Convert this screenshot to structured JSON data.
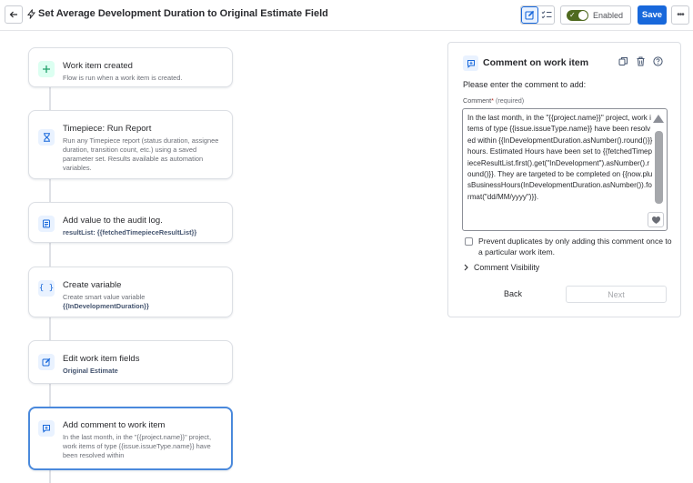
{
  "header": {
    "title": "Set Average Development Duration to Original Estimate Field",
    "enabled_label": "Enabled",
    "save_label": "Save",
    "more_label": "•••"
  },
  "flow": {
    "cards": [
      {
        "title": "Work item created",
        "description": "Flow is run when a work item is created.",
        "bold": "",
        "icon": "plus-icon"
      },
      {
        "title": "Timepiece: Run Report",
        "description": "Run any Timepiece report (status duration, assignee duration, transition count, etc.) using a saved parameter set. Results available as automation variables.",
        "bold": "",
        "icon": "hourglass-icon"
      },
      {
        "title": "Add value to the audit log.",
        "description": "",
        "bold": "resultList: {{fetchedTimepieceResultList}}",
        "icon": "audit-log-icon"
      },
      {
        "title": "Create variable",
        "description": "Create smart value variable",
        "bold": "{{InDevelopmentDuration}}",
        "icon": "braces-icon"
      },
      {
        "title": "Edit work item fields",
        "description": "",
        "bold": "Original Estimate",
        "icon": "edit-icon"
      },
      {
        "title": "Add comment to work item",
        "description": "In the last month, in the \"{{project.name}}\" project, work items of type {{issue.issueType.name}} have been resolved within",
        "bold": "",
        "icon": "comment-add-icon"
      }
    ]
  },
  "panel": {
    "title": "Comment on work item",
    "prompt": "Please enter the comment to add:",
    "comment_label": "Comment",
    "required_mark": "*",
    "required_text": "(required)",
    "comment_value": "In the last month, in the \"{{project.name}}\" project, work items of type {{issue.issueType.name}} have been resolved within {{InDevelopmentDuration.asNumber().round()}} hours. Estimated Hours have been set to {{fetchedTimepieceResultList.first().get(\"InDevelopment\").asNumber().round()}}. They are targeted to be completed on {{now.plusBusinessHours(InDevelopmentDuration.asNumber()).format(\"dd/MM/yyyy\")}}.",
    "prevent_duplicates": "Prevent duplicates by only adding this comment once to a particular work item.",
    "visibility_label": "Comment Visibility",
    "back_label": "Back",
    "next_label": "Next"
  },
  "colors": {
    "accent": "#1868db",
    "toggle_on": "#4f6a1f",
    "icon_green": "#dcfff1",
    "icon_blue": "#e9f2ff"
  }
}
